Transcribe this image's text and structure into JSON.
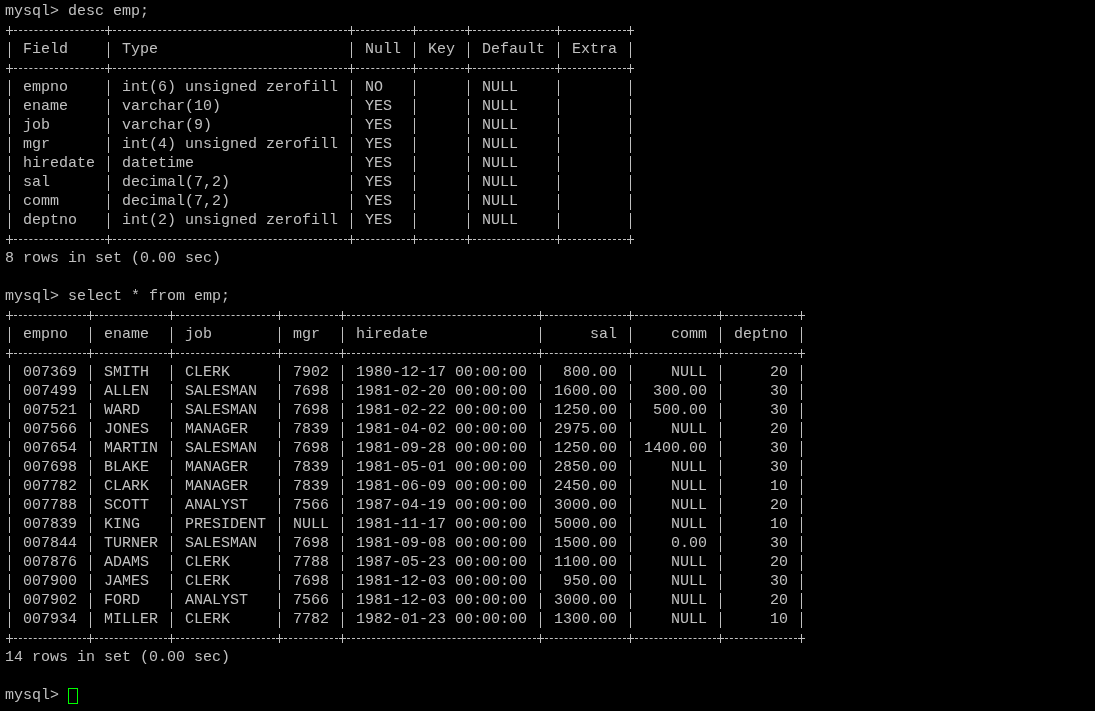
{
  "terminal": [
    {
      "kind": "command",
      "prompt": "mysql>",
      "text": "desc emp;"
    },
    {
      "kind": "table",
      "columns": [
        {
          "label": "Field",
          "kind": "text"
        },
        {
          "label": "Type",
          "kind": "text"
        },
        {
          "label": "Null",
          "kind": "text"
        },
        {
          "label": "Key",
          "kind": "text"
        },
        {
          "label": "Default",
          "kind": "text"
        },
        {
          "label": "Extra",
          "kind": "text"
        }
      ],
      "rows": [
        [
          "empno",
          "int(6) unsigned zerofill",
          "NO",
          null,
          "NULL",
          null
        ],
        [
          "ename",
          "varchar(10)",
          "YES",
          null,
          "NULL",
          null
        ],
        [
          "job",
          "varchar(9)",
          "YES",
          null,
          "NULL",
          null
        ],
        [
          "mgr",
          "int(4) unsigned zerofill",
          "YES",
          null,
          "NULL",
          null
        ],
        [
          "hiredate",
          "datetime",
          "YES",
          null,
          "NULL",
          null
        ],
        [
          "sal",
          "decimal(7,2)",
          "YES",
          null,
          "NULL",
          null
        ],
        [
          "comm",
          "decimal(7,2)",
          "YES",
          null,
          "NULL",
          null
        ],
        [
          "deptno",
          "int(2) unsigned zerofill",
          "YES",
          null,
          "NULL",
          null
        ]
      ]
    },
    {
      "kind": "message",
      "text": "8 rows in set (0.00 sec)"
    },
    {
      "kind": "command",
      "prompt": "mysql>",
      "text": "select * from emp;"
    },
    {
      "kind": "table",
      "columns": [
        {
          "label": "empno",
          "kind": "text"
        },
        {
          "label": "ename",
          "kind": "text"
        },
        {
          "label": "job",
          "kind": "text"
        },
        {
          "label": "mgr",
          "kind": "text"
        },
        {
          "label": "hiredate",
          "kind": "text"
        },
        {
          "label": "sal",
          "kind": "number"
        },
        {
          "label": "comm",
          "kind": "number"
        },
        {
          "label": "deptno",
          "kind": "number"
        }
      ],
      "rows": [
        [
          "007369",
          "SMITH",
          "CLERK",
          "7902",
          "1980-12-17 00:00:00",
          "800.00",
          "NULL",
          "20"
        ],
        [
          "007499",
          "ALLEN",
          "SALESMAN",
          "7698",
          "1981-02-20 00:00:00",
          "1600.00",
          "300.00",
          "30"
        ],
        [
          "007521",
          "WARD",
          "SALESMAN",
          "7698",
          "1981-02-22 00:00:00",
          "1250.00",
          "500.00",
          "30"
        ],
        [
          "007566",
          "JONES",
          "MANAGER",
          "7839",
          "1981-04-02 00:00:00",
          "2975.00",
          "NULL",
          "20"
        ],
        [
          "007654",
          "MARTIN",
          "SALESMAN",
          "7698",
          "1981-09-28 00:00:00",
          "1250.00",
          "1400.00",
          "30"
        ],
        [
          "007698",
          "BLAKE",
          "MANAGER",
          "7839",
          "1981-05-01 00:00:00",
          "2850.00",
          "NULL",
          "30"
        ],
        [
          "007782",
          "CLARK",
          "MANAGER",
          "7839",
          "1981-06-09 00:00:00",
          "2450.00",
          "NULL",
          "10"
        ],
        [
          "007788",
          "SCOTT",
          "ANALYST",
          "7566",
          "1987-04-19 00:00:00",
          "3000.00",
          "NULL",
          "20"
        ],
        [
          "007839",
          "KING",
          "PRESIDENT",
          "NULL",
          "1981-11-17 00:00:00",
          "5000.00",
          "NULL",
          "10"
        ],
        [
          "007844",
          "TURNER",
          "SALESMAN",
          "7698",
          "1981-09-08 00:00:00",
          "1500.00",
          "0.00",
          "30"
        ],
        [
          "007876",
          "ADAMS",
          "CLERK",
          "7788",
          "1987-05-23 00:00:00",
          "1100.00",
          "NULL",
          "20"
        ],
        [
          "007900",
          "JAMES",
          "CLERK",
          "7698",
          "1981-12-03 00:00:00",
          "950.00",
          "NULL",
          "30"
        ],
        [
          "007902",
          "FORD",
          "ANALYST",
          "7566",
          "1981-12-03 00:00:00",
          "3000.00",
          "NULL",
          "20"
        ],
        [
          "007934",
          "MILLER",
          "CLERK",
          "7782",
          "1982-01-23 00:00:00",
          "1300.00",
          "NULL",
          "10"
        ]
      ]
    },
    {
      "kind": "message",
      "text": "14 rows in set (0.00 sec)"
    },
    {
      "kind": "command",
      "prompt": "mysql>",
      "cursor": true
    }
  ]
}
